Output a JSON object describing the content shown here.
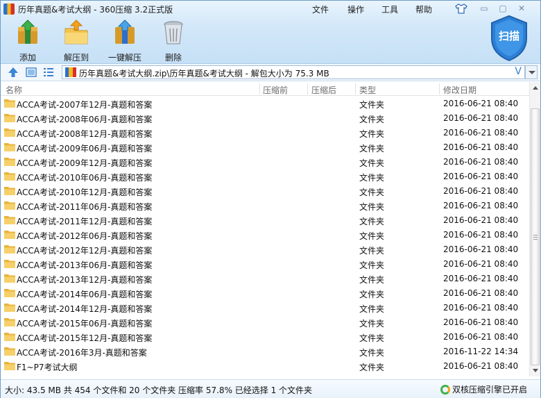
{
  "window": {
    "title": "历年真题&考试大纲 - 360压缩 3.2正式版"
  },
  "menu": {
    "file": "文件",
    "operate": "操作",
    "tools": "工具",
    "help": "帮助"
  },
  "window_controls": {
    "min": "▭",
    "max": "▢",
    "close": "✕"
  },
  "toolbar": {
    "add": "添加",
    "extract_to": "解压到",
    "one_click": "一键解压",
    "delete": "删除",
    "scan": "扫描"
  },
  "address": {
    "path": "历年真题&考试大纲.zip\\历年真题&考试大纲 - 解包大小为 75.3 MB",
    "v_mark": "V"
  },
  "columns": {
    "name": "名称",
    "before": "压缩前",
    "after": "压缩后",
    "type": "类型",
    "modified": "修改日期"
  },
  "files": [
    {
      "name": "ACCA考试-2007年12月-真题和答案",
      "type": "文件夹",
      "date": "2016-06-21 08:40"
    },
    {
      "name": "ACCA考试-2008年06月-真题和答案",
      "type": "文件夹",
      "date": "2016-06-21 08:40"
    },
    {
      "name": "ACCA考试-2008年12月-真题和答案",
      "type": "文件夹",
      "date": "2016-06-21 08:40"
    },
    {
      "name": "ACCA考试-2009年06月-真题和答案",
      "type": "文件夹",
      "date": "2016-06-21 08:40"
    },
    {
      "name": "ACCA考试-2009年12月-真题和答案",
      "type": "文件夹",
      "date": "2016-06-21 08:40"
    },
    {
      "name": "ACCA考试-2010年06月-真题和答案",
      "type": "文件夹",
      "date": "2016-06-21 08:40"
    },
    {
      "name": "ACCA考试-2010年12月-真题和答案",
      "type": "文件夹",
      "date": "2016-06-21 08:40"
    },
    {
      "name": "ACCA考试-2011年06月-真题和答案",
      "type": "文件夹",
      "date": "2016-06-21 08:40"
    },
    {
      "name": "ACCA考试-2011年12月-真题和答案",
      "type": "文件夹",
      "date": "2016-06-21 08:40"
    },
    {
      "name": "ACCA考试-2012年06月-真题和答案",
      "type": "文件夹",
      "date": "2016-06-21 08:40"
    },
    {
      "name": "ACCA考试-2012年12月-真题和答案",
      "type": "文件夹",
      "date": "2016-06-21 08:40"
    },
    {
      "name": "ACCA考试-2013年06月-真题和答案",
      "type": "文件夹",
      "date": "2016-06-21 08:40"
    },
    {
      "name": "ACCA考试-2013年12月-真题和答案",
      "type": "文件夹",
      "date": "2016-06-21 08:40"
    },
    {
      "name": "ACCA考试-2014年06月-真题和答案",
      "type": "文件夹",
      "date": "2016-06-21 08:40"
    },
    {
      "name": "ACCA考试-2014年12月-真题和答案",
      "type": "文件夹",
      "date": "2016-06-21 08:40"
    },
    {
      "name": "ACCA考试-2015年06月-真题和答案",
      "type": "文件夹",
      "date": "2016-06-21 08:40"
    },
    {
      "name": "ACCA考试-2015年12月-真题和答案",
      "type": "文件夹",
      "date": "2016-06-21 08:40"
    },
    {
      "name": "ACCA考试-2016年3月-真题和答案",
      "type": "文件夹",
      "date": "2016-11-22 14:34"
    },
    {
      "name": "F1~P7考试大纲",
      "type": "文件夹",
      "date": "2016-06-21 08:40"
    }
  ],
  "status": {
    "summary": "大小: 43.5 MB 共 454 个文件和 20 个文件夹 压缩率 57.8% 已经选择 1 个文件夹",
    "engine": "双核压缩引擎已开启"
  },
  "icons": {
    "app": "app-icon",
    "skin": "shirt-icon",
    "add": "add-archive-icon",
    "extract": "extract-folder-icon",
    "oneclick": "one-click-extract-icon",
    "delete": "trash-icon",
    "scan": "shield-icon",
    "up": "up-arrow-icon",
    "view_thumb": "thumbnail-view-icon",
    "view_list": "list-view-icon",
    "folder": "folder-icon",
    "archive": "archive-icon"
  },
  "colors": {
    "accent": "#3a7fcc",
    "folder": "#f2c24a",
    "shield": "#2d7fd6"
  }
}
